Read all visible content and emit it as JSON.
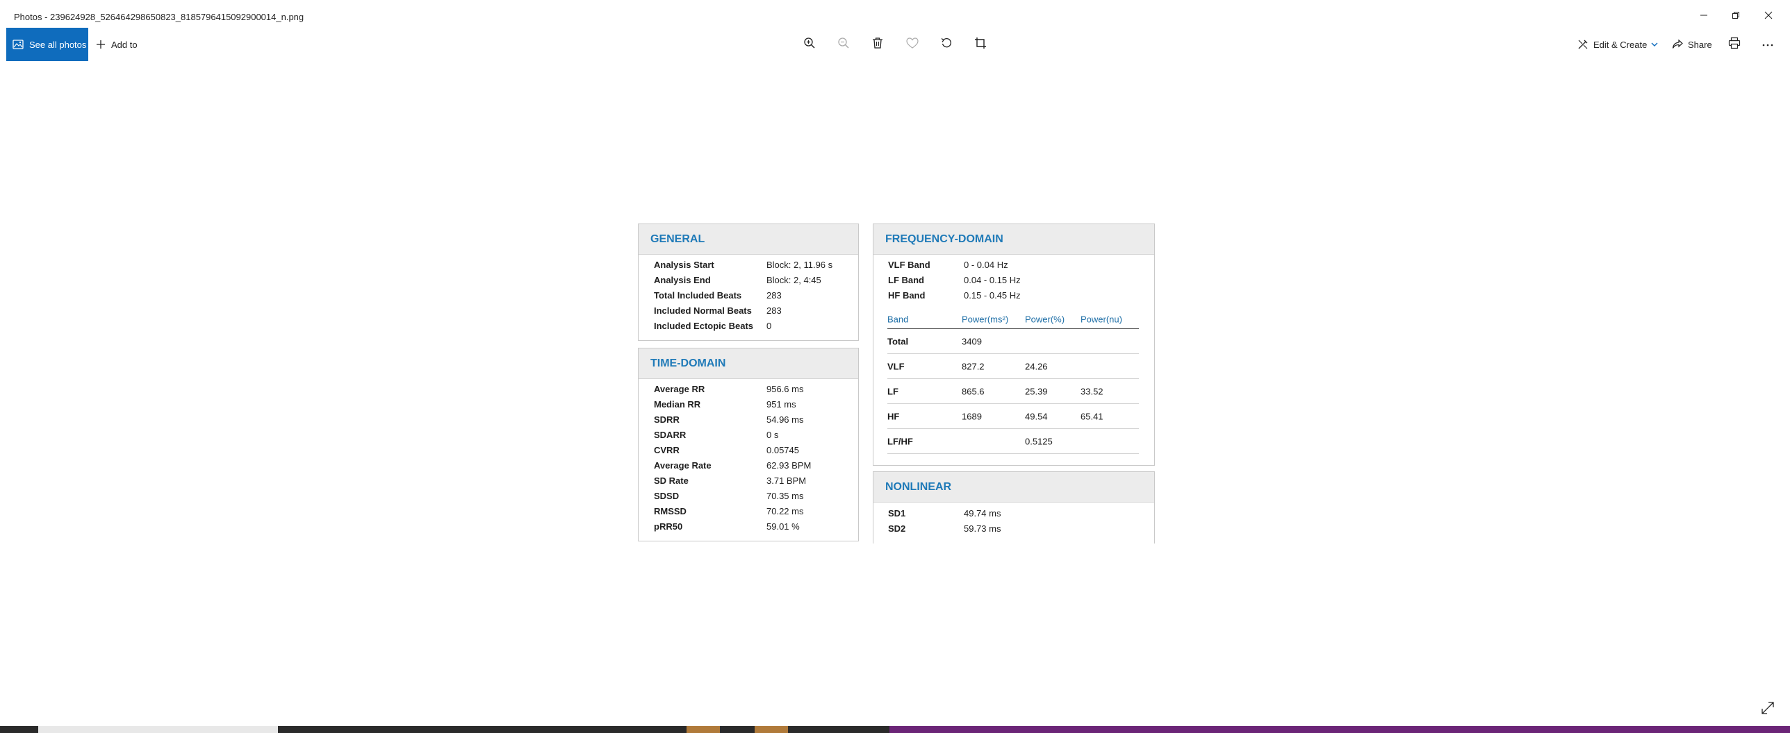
{
  "window": {
    "title": "Photos - 239624928_526464298650823_8185796415092900014_n.png",
    "icons": [
      "minimize-icon",
      "restore-icon",
      "close-icon"
    ]
  },
  "toolbar": {
    "see_all_label": "See all photos",
    "add_to_label": "Add to",
    "edit_create_label": "Edit & Create",
    "share_label": "Share",
    "accent_color": "#0f6cbd",
    "center_icons": [
      "zoom-in-icon",
      "zoom-out-icon",
      "delete-icon",
      "favorite-icon",
      "rotate-icon",
      "crop-icon"
    ]
  },
  "report": {
    "heading_color": "#1f7ab8",
    "general": {
      "title": "GENERAL",
      "rows": [
        {
          "label": "Analysis Start",
          "value": "Block: 2, 11.96 s"
        },
        {
          "label": "Analysis End",
          "value": "Block: 2, 4:45"
        },
        {
          "label": "Total Included Beats",
          "value": "283"
        },
        {
          "label": "Included Normal Beats",
          "value": "283"
        },
        {
          "label": "Included Ectopic Beats",
          "value": "0"
        }
      ]
    },
    "time_domain": {
      "title": "TIME-DOMAIN",
      "rows": [
        {
          "label": "Average RR",
          "value": "956.6 ms"
        },
        {
          "label": "Median RR",
          "value": "951 ms"
        },
        {
          "label": "SDRR",
          "value": "54.96 ms"
        },
        {
          "label": "SDARR",
          "value": "0 s"
        },
        {
          "label": "CVRR",
          "value": "0.05745"
        },
        {
          "label": "Average Rate",
          "value": "62.93 BPM"
        },
        {
          "label": "SD Rate",
          "value": "3.71 BPM"
        },
        {
          "label": "SDSD",
          "value": "70.35 ms"
        },
        {
          "label": "RMSSD",
          "value": "70.22 ms"
        },
        {
          "label": "pRR50",
          "value": "59.01 %"
        }
      ]
    },
    "frequency_domain": {
      "title": "FREQUENCY-DOMAIN",
      "bands": [
        {
          "label": "VLF Band",
          "value": "0 - 0.04 Hz"
        },
        {
          "label": "LF Band",
          "value": "0.04 - 0.15 Hz"
        },
        {
          "label": "HF Band",
          "value": "0.15 - 0.45 Hz"
        }
      ],
      "table": {
        "headers": [
          "Band",
          "Power(ms²)",
          "Power(%)",
          "Power(nu)"
        ],
        "rows": [
          [
            "Total",
            "3409",
            "",
            ""
          ],
          [
            "VLF",
            "827.2",
            "24.26",
            ""
          ],
          [
            "LF",
            "865.6",
            "25.39",
            "33.52"
          ],
          [
            "HF",
            "1689",
            "49.54",
            "65.41"
          ],
          [
            "LF/HF",
            "",
            "0.5125",
            ""
          ]
        ]
      }
    },
    "nonlinear": {
      "title": "NONLINEAR",
      "rows": [
        {
          "label": "SD1",
          "value": "49.74 ms"
        },
        {
          "label": "SD2",
          "value": "59.73 ms"
        }
      ]
    }
  }
}
